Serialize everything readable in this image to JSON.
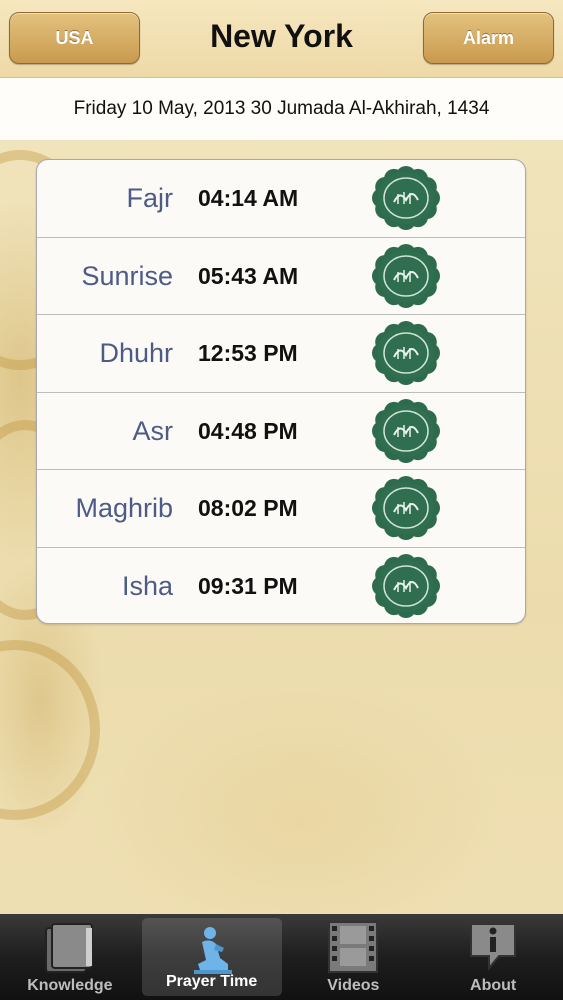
{
  "header": {
    "left_button": "USA",
    "title": "New York",
    "right_button": "Alarm"
  },
  "date_line": "Friday 10 May, 2013 30 Jumada Al-Akhirah, 1434",
  "prayers": [
    {
      "name": "Fajr",
      "time": "04:14 AM"
    },
    {
      "name": "Sunrise",
      "time": "05:43 AM"
    },
    {
      "name": "Dhuhr",
      "time": "12:53 PM"
    },
    {
      "name": "Asr",
      "time": "04:48 PM"
    },
    {
      "name": "Maghrib",
      "time": "08:02 PM"
    },
    {
      "name": "Isha",
      "time": "09:31 PM"
    }
  ],
  "tabs": [
    {
      "label": "Knowledge",
      "icon": "book-icon",
      "active": false
    },
    {
      "label": "Prayer Time",
      "icon": "praying-person-icon",
      "active": true
    },
    {
      "label": "Videos",
      "icon": "film-strip-icon",
      "active": false
    },
    {
      "label": "About",
      "icon": "info-icon",
      "active": false
    }
  ],
  "colors": {
    "prayer_name": "#4d5b86",
    "medal": "#2e6b4c",
    "header_button": "#c99a4f"
  }
}
